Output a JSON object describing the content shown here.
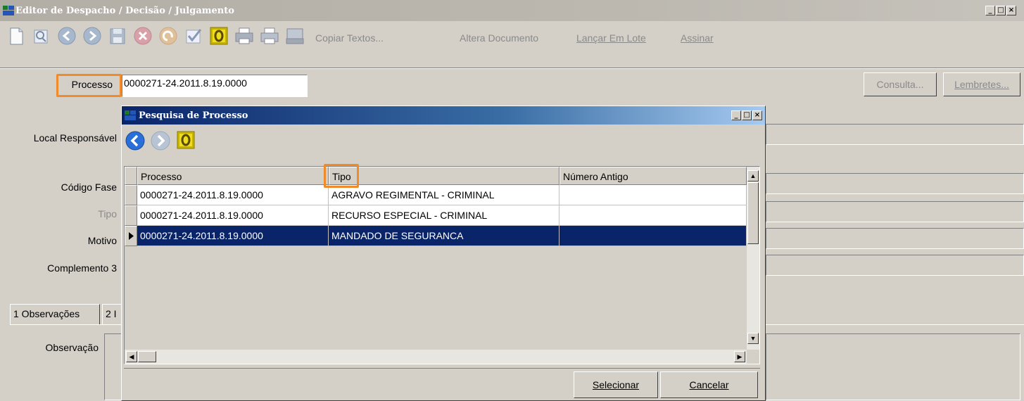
{
  "window": {
    "title": "Editor de Despacho / Decisão / Julgamento",
    "controls": [
      "_",
      "□",
      "×"
    ]
  },
  "toolbar": {
    "icons": [
      "new-document-icon",
      "search-icon",
      "back-icon",
      "forward-icon",
      "save-icon",
      "cancel-icon",
      "undo-icon",
      "check-icon",
      "zero-icon",
      "print-preview-icon",
      "print-icon",
      "scanner-icon"
    ],
    "copiar_textos": "Copiar Textos...",
    "altera_documento": "Altera Documento",
    "lancar_em_lote": "Lançar Em Lote",
    "assinar": "Assinar"
  },
  "form": {
    "processo_label": "Processo",
    "processo_value": "0000271-24.2011.8.19.0000",
    "consulta_button": "Consulta...",
    "lembretes_button": "Lembretes...",
    "local_responsavel_label": "Local Responsável",
    "codigo_fase_label": "Código Fase",
    "tipo_label": "Tipo",
    "motivo_label": "Motivo",
    "complemento3_label": "Complemento 3",
    "observacao_label": "Observação"
  },
  "tabs": [
    {
      "label": "1 Observações"
    },
    {
      "label": "2 I"
    }
  ],
  "dialog": {
    "title": "Pesquisa de Processo",
    "controls": [
      "_",
      "□",
      "×"
    ],
    "columns": [
      "Processo",
      "Tipo",
      "Número Antigo"
    ],
    "rows": [
      {
        "processo": "0000271-24.2011.8.19.0000",
        "tipo": "AGRAVO REGIMENTAL - CRIMINAL",
        "numero_antigo": ""
      },
      {
        "processo": "0000271-24.2011.8.19.0000",
        "tipo": "RECURSO ESPECIAL - CRIMINAL",
        "numero_antigo": ""
      },
      {
        "processo": "0000271-24.2011.8.19.0000",
        "tipo": "MANDADO DE SEGURANCA",
        "numero_antigo": ""
      }
    ],
    "selected_row_index": 2,
    "selecionar_button": "Selecionar",
    "cancelar_button": "Cancelar"
  },
  "colors": {
    "highlight": "#f08a2a",
    "selection": "#0a246a",
    "dialog_title_start": "#0a246a",
    "window_bg": "#d4d0c8"
  }
}
